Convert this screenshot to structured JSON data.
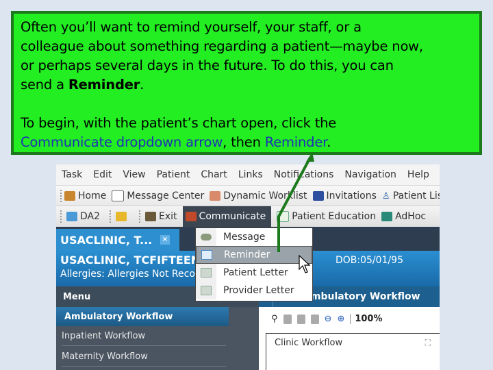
{
  "callout": {
    "line1": "Often you’ll want to remind yourself, your staff, or a",
    "line2": "colleague about something regarding a patient—maybe now,",
    "line3": "or perhaps several days in the future.  To do this, you can",
    "line4_pre": "send a ",
    "line4_bold": "Reminder",
    "line4_post": ".",
    "line5": "To begin, with the patient’s chart open, click the",
    "line6_blue1": "Communicate dropdown arrow",
    "line6_mid": ", then ",
    "line6_blue2": "Reminder",
    "line6_post": "."
  },
  "menubar": [
    "Task",
    "Edit",
    "View",
    "Patient",
    "Chart",
    "Links",
    "Notifications",
    "Navigation",
    "Help"
  ],
  "toolbar1": [
    {
      "icon": "home-icon",
      "label": "Home"
    },
    {
      "icon": "message-center-icon",
      "label": "Message Center"
    },
    {
      "icon": "worklist-icon",
      "label": "Dynamic Worklist"
    },
    {
      "icon": "invitations-icon",
      "label": "Invitations"
    },
    {
      "icon": "patient-list-icon",
      "label": "Patient List"
    }
  ],
  "toolbar2": {
    "da2": "DA2",
    "exit": "Exit",
    "communicate": "Communicate",
    "patient_education": "Patient Education",
    "adhoc": "AdHoc"
  },
  "patient_tab": {
    "label": "USACLINIC, T...",
    "close": "×"
  },
  "banner": {
    "name": "USACLINIC, TCFIFTEEN",
    "allergies": "Allergies: Allergies Not Recorded",
    "dob": "DOB:05/01/95"
  },
  "menu_header": "Menu",
  "ambulatory_header": "Ambulatory Workflow",
  "sidebar": {
    "active": "Ambulatory Workflow",
    "items": [
      "Inpatient Workflow",
      "Maternity Workflow"
    ]
  },
  "content": {
    "zoom": "100%",
    "panel_title": "Clinic Workflow"
  },
  "dropdown": {
    "items": [
      {
        "icon": "message-icon",
        "label": "Message"
      },
      {
        "icon": "reminder-icon",
        "label": "Reminder",
        "highlighted": true
      },
      {
        "icon": "patient-letter-icon",
        "label": "Patient Letter"
      },
      {
        "icon": "provider-letter-icon",
        "label": "Provider Letter"
      }
    ]
  },
  "colors": {
    "callout_bg": "#22ee22",
    "callout_border": "#1c7a1c",
    "arrow": "#1c7a1c",
    "link_blue": "#1f2fb8"
  }
}
